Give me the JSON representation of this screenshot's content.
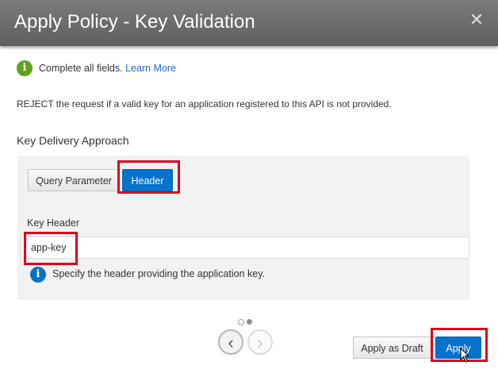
{
  "dialog": {
    "title": "Apply Policy - Key Validation",
    "close_glyph": "✕"
  },
  "notice": {
    "icon": "info-icon",
    "text": "Complete all fields.",
    "link": "Learn More"
  },
  "description": "REJECT the request if a valid key for an application registered to this API is not provided.",
  "key_delivery": {
    "heading": "Key Delivery Approach",
    "options": [
      "Query Parameter",
      "Header"
    ],
    "selected": "Header"
  },
  "key_header": {
    "label": "Key Header",
    "value": "app-key",
    "hint_icon": "info-icon",
    "hint": "Specify the header providing the application key."
  },
  "pagination": {
    "current_page": 2,
    "total_pages": 2,
    "prev_glyph": "‹",
    "next_glyph": "›"
  },
  "footer": {
    "draft_label": "Apply as Draft",
    "apply_label": "Apply"
  },
  "colors": {
    "accent": "#0572ce",
    "highlight_box": "#e0001a",
    "success_icon": "#5ea21b",
    "info_icon": "#0572ce",
    "titlebar": "#6b6b6b"
  }
}
